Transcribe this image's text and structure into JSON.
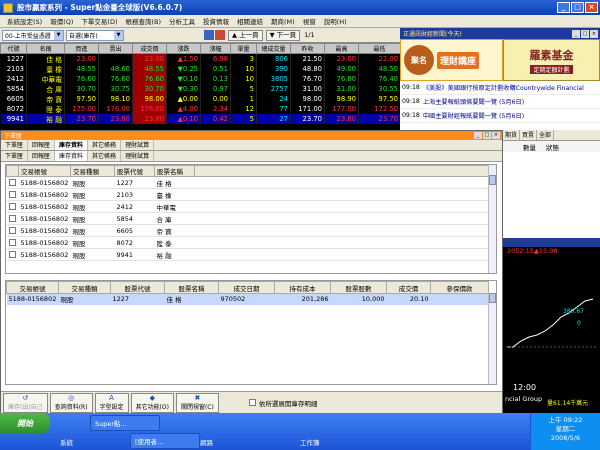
{
  "window": {
    "title": "股市贏家系列 - Super點金臺全球版(V6.6.0.7)"
  },
  "menu": [
    "系統設定(S)",
    "報價(Q)",
    "下單交易(D)",
    "帳務查詢(B)",
    "分析工具",
    "投資情報",
    "相關連結",
    "期商(M)",
    "視窗",
    "說明(H)"
  ],
  "toolbar": {
    "market": "00-上市受益憑證",
    "group": "自選(庫存)",
    "prev": "上一頁",
    "next": "下一頁",
    "page": "1/1"
  },
  "quote": {
    "headers": [
      "代號",
      "名稱",
      "買進",
      "賣出",
      "成交價",
      "漲跌",
      "漲幅",
      "單量",
      "總成交量",
      "昨收",
      "最高",
      "最低"
    ],
    "rows": [
      {
        "code": "1227",
        "name": "佳 格",
        "bid": "23.00",
        "ask": "",
        "price": "23.00",
        "chg": "▲1.50",
        "pct": "6.98",
        "vol": "3",
        "total": "806",
        "prev": "21.50",
        "high": "23.00",
        "low": "22.00",
        "color": "r"
      },
      {
        "code": "2103",
        "name": "臺 橡",
        "bid": "48.55",
        "ask": "48.60",
        "price": "48.55",
        "chg": "▼0.25",
        "pct": "0.51",
        "vol": "10",
        "total": "390",
        "prev": "48.80",
        "high": "49.00",
        "low": "48.50",
        "color": "g"
      },
      {
        "code": "2412",
        "name": "中華電",
        "bid": "76.60",
        "ask": "76.60",
        "price": "76.60",
        "chg": "▼0.10",
        "pct": "0.13",
        "vol": "10",
        "total": "3805",
        "prev": "76.70",
        "high": "76.80",
        "low": "76.40",
        "color": "g"
      },
      {
        "code": "5854",
        "name": "合 庫",
        "bid": "30.70",
        "ask": "30.75",
        "price": "30.70",
        "chg": "▼0.30",
        "pct": "0.97",
        "vol": "5",
        "total": "2757",
        "prev": "31.00",
        "high": "31.00",
        "low": "30.55",
        "color": "g"
      },
      {
        "code": "6605",
        "name": "帝 寶",
        "bid": "97.50",
        "ask": "98.10",
        "price": "98.00",
        "chg": "▲0.00",
        "pct": "0.00",
        "vol": "1",
        "total": "24",
        "prev": "98.00",
        "high": "98.90",
        "low": "97.50",
        "color": "y"
      },
      {
        "code": "8072",
        "name": "陞 泰",
        "bid": "175.00",
        "ask": "176.00",
        "price": "176.00",
        "chg": "▲4.00",
        "pct": "2.34",
        "vol": "12",
        "total": "77",
        "prev": "171.00",
        "high": "177.00",
        "low": "172.50",
        "color": "r"
      },
      {
        "code": "9941",
        "name": "裕 融",
        "bid": "23.70",
        "ask": "23.80",
        "price": "23.80",
        "chg": "▲0.10",
        "pct": "0.42",
        "vol": "5",
        "total": "27",
        "prev": "23.70",
        "high": "23.80",
        "low": "23.70",
        "color": "r"
      }
    ]
  },
  "news": {
    "header": "正通訊財經新聞(今天)",
    "ad_left": "理財講座",
    "ad_seal": "聚名",
    "ad_right_big": "羅素基金",
    "ad_right_small": "定期定額計劃",
    "items": [
      {
        "time": "09:18",
        "text": "《美股》美國銀行按原定計劃收購Countrywide Financial"
      },
      {
        "time": "09:18",
        "text": "上海主要報紙頭條要聞一覽 (5月6日)"
      },
      {
        "time": "09:18",
        "text": "中國主要財經報紙要聞一覽 (5月6日)"
      }
    ]
  },
  "dialog": {
    "title": "下單匣",
    "tabs": [
      "下單匣",
      "回報匣",
      "庫存資料",
      "其它帳務",
      "理財試算"
    ],
    "active_tab": "庫存資料",
    "grid1_headers": [
      "交易帳號",
      "交易種類",
      "股票代號",
      "股票名稱"
    ],
    "grid1_rows": [
      [
        "5188-0156802",
        "現股",
        "1227",
        "佳 格"
      ],
      [
        "5188-0156802",
        "現股",
        "2103",
        "臺 橡"
      ],
      [
        "5188-0156802",
        "現股",
        "2412",
        "中華電"
      ],
      [
        "5188-0156802",
        "現股",
        "5854",
        "合 庫"
      ],
      [
        "5188-0156802",
        "現股",
        "6605",
        "帝 寶"
      ],
      [
        "5188-0156802",
        "現股",
        "8072",
        "陞 泰"
      ],
      [
        "5188-0156802",
        "現股",
        "9941",
        "裕 融"
      ]
    ],
    "grid2_headers": [
      "交易帳號",
      "交易種類",
      "股票代號",
      "股票名稱",
      "成交日期",
      "持有成本",
      "股票股數",
      "成交價",
      "參保價款"
    ],
    "grid2_rows": [
      [
        "5188-0156802",
        "現股",
        "1227",
        "佳 格",
        "970502",
        "201,286",
        "10,000",
        "20.10",
        ""
      ]
    ],
    "buttons": [
      {
        "icon": "↺",
        "label": "庫存(出)自己",
        "disabled": true
      },
      {
        "icon": "◎",
        "label": "查詢資料(R)"
      },
      {
        "icon": "A",
        "label": "字型設定"
      },
      {
        "icon": "◆",
        "label": "其它功能(O)"
      },
      {
        "icon": "✖",
        "label": "關閉視窗(C)"
      }
    ],
    "checkbox_label": "依所選展開庫存明細"
  },
  "orders": {
    "tabs": [
      "期貨",
      "買賣",
      "全部"
    ],
    "headers": [
      "數量",
      "狀態"
    ]
  },
  "chart": {
    "price_info": "2052.15▲15.08",
    "axis": [
      "0",
      "380.67",
      "ncial Group"
    ],
    "time": "12:00",
    "value_label": "量61.14千萬元"
  },
  "taskbar": {
    "start": "開始",
    "items": [
      "Super點...",
      "[使用者..."
    ],
    "quick": [
      "系統",
      "網路",
      "工作簿"
    ],
    "clock": "上午 09:22",
    "day": "星期二",
    "date": "2008/5/6"
  }
}
